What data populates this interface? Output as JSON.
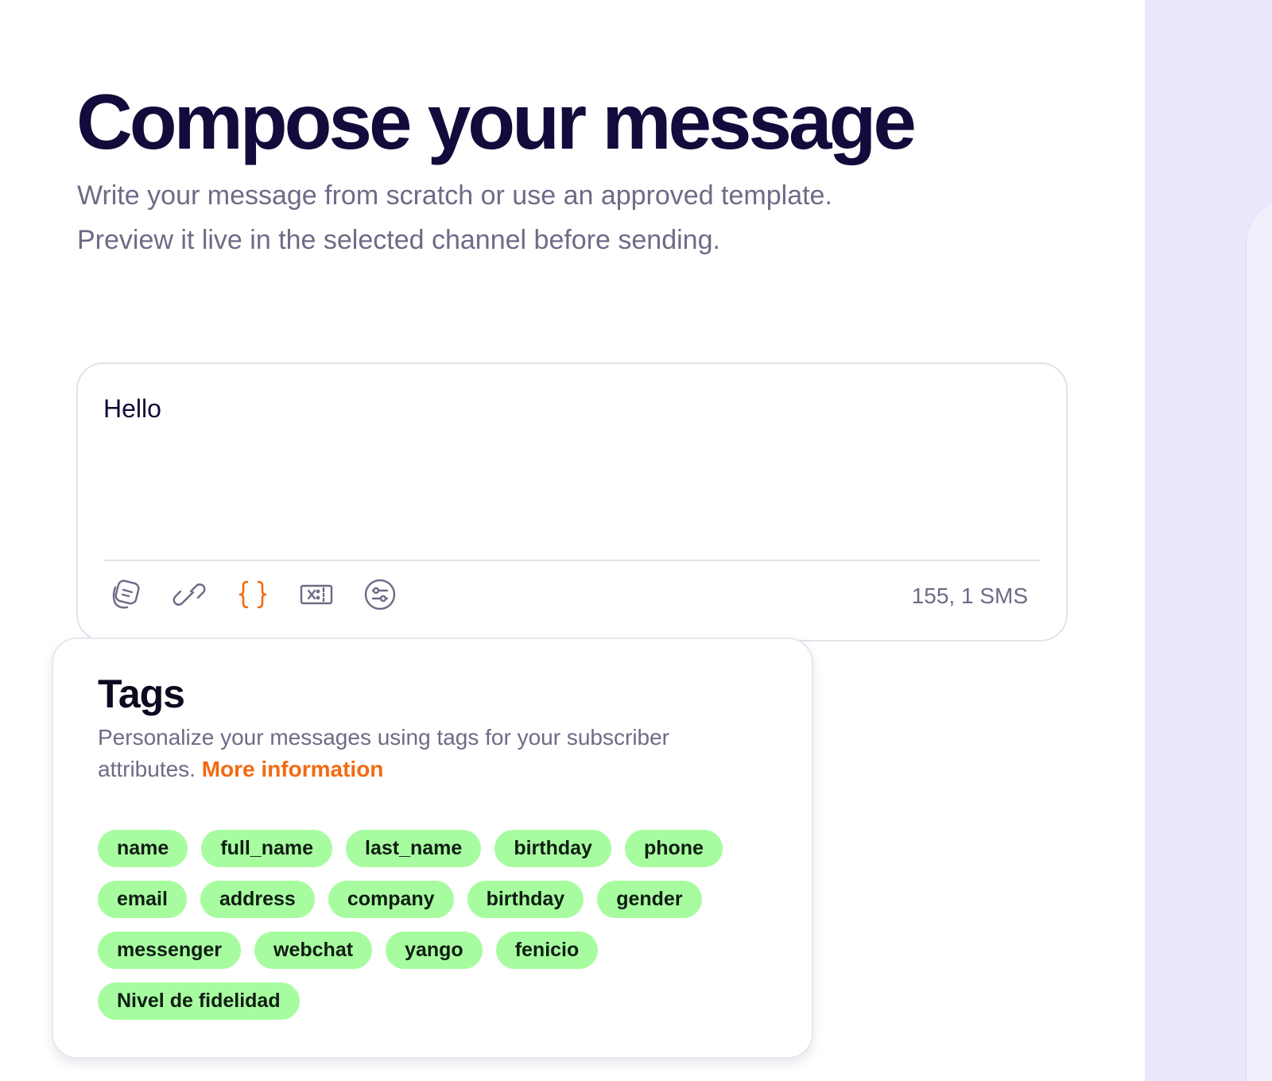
{
  "page": {
    "title": "Compose your message",
    "subtitle_line1": "Write your message from scratch or use an approved template.",
    "subtitle_line2": "Preview it live in the selected channel before sending."
  },
  "composer": {
    "message_value": "Hello",
    "counter": "155, 1 SMS",
    "toolbar": [
      {
        "icon": "template-icon",
        "active": false
      },
      {
        "icon": "link-icon",
        "active": false
      },
      {
        "icon": "braces-icon",
        "active": true
      },
      {
        "icon": "coupon-icon",
        "active": false
      },
      {
        "icon": "settings-sliders-icon",
        "active": false
      }
    ]
  },
  "tags_panel": {
    "title": "Tags",
    "description": "Personalize your messages using tags for your subscriber attributes. ",
    "more_link": "More information",
    "tags": [
      "name",
      "full_name",
      "last_name",
      "birthday",
      "phone",
      "email",
      "address",
      "company",
      "birthday",
      "gender",
      "messenger",
      "webchat",
      "yango",
      "fenicio",
      "Nivel de fidelidad"
    ]
  },
  "colors": {
    "accent": "#f36a10",
    "tag_bg": "#a7fca0",
    "panel_bg": "#ece6fb",
    "title": "#140a3b",
    "muted": "#6f6a86"
  }
}
